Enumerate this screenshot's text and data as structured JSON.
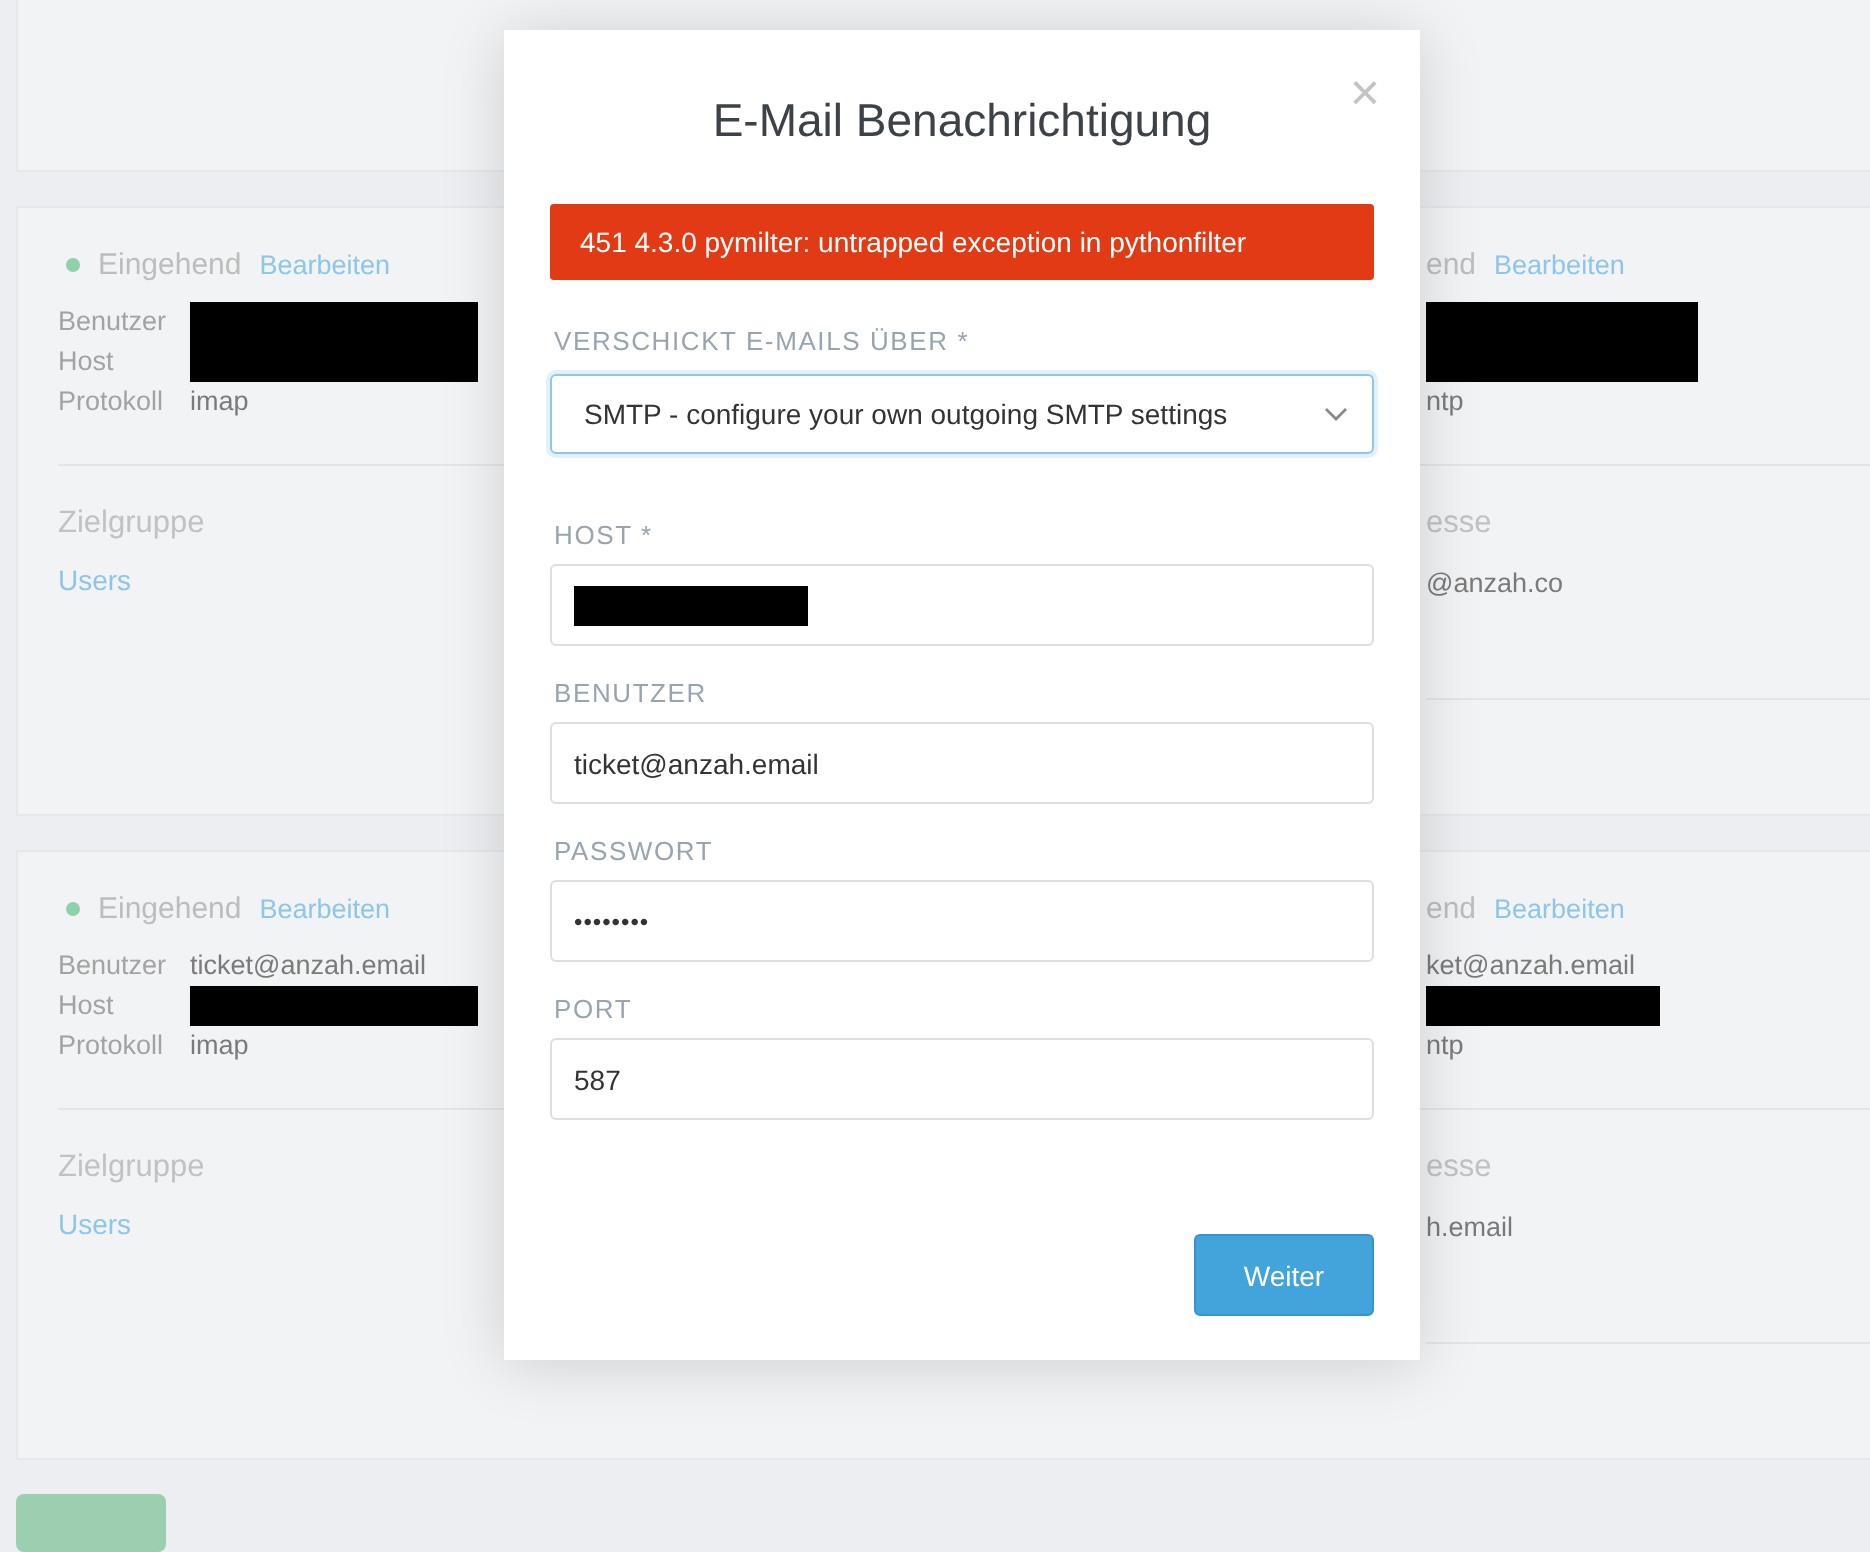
{
  "cards": [
    {
      "left": {
        "status": {
          "label": "Eingehend",
          "color": "#8fd1a8"
        },
        "edit_link": "Bearbeiten",
        "fields": [
          {
            "label": "Benutzer",
            "kind": "redacted"
          },
          {
            "label": "Host",
            "kind": "redacted"
          },
          {
            "label": "Protokoll",
            "kind": "text",
            "value": "imap"
          }
        ],
        "section": {
          "title": "Zielgruppe",
          "link": "Users"
        }
      },
      "right": {
        "status_fragment": "end",
        "edit_link": "Bearbeiten",
        "fields": [
          {
            "kind": "redacted"
          },
          {
            "kind": "redacted"
          },
          {
            "kind": "text",
            "value": "ntp"
          }
        ],
        "section": {
          "title_fragment": "esse",
          "value_fragment": "@anzah.co"
        }
      }
    },
    {
      "left": {
        "status": {
          "label": "Eingehend",
          "color": "#8fd1a8"
        },
        "edit_link": "Bearbeiten",
        "fields": [
          {
            "label": "Benutzer",
            "kind": "text",
            "value": "ticket@anzah.email"
          },
          {
            "label": "Host",
            "kind": "redacted"
          },
          {
            "label": "Protokoll",
            "kind": "text",
            "value": "imap"
          }
        ],
        "section": {
          "title": "Zielgruppe",
          "link": "Users"
        }
      },
      "right": {
        "status_fragment": "end",
        "edit_link": "Bearbeiten",
        "fields": [
          {
            "kind": "text",
            "value": "ket@anzah.email"
          },
          {
            "kind": "redacted"
          },
          {
            "kind": "text",
            "value": "ntp"
          }
        ],
        "section": {
          "title_fragment": "esse",
          "value_fragment": "h.email"
        }
      }
    }
  ],
  "modal": {
    "title": "E-Mail Benachrichtigung",
    "close": "×",
    "error": "451 4.3.0 pymilter: untrapped exception in pythonfilter",
    "send_via": {
      "label": "VERSCHICKT E-MAILS ÜBER *",
      "value": "SMTP - configure your own outgoing SMTP settings"
    },
    "fields": [
      {
        "label": "HOST *",
        "kind": "redacted"
      },
      {
        "label": "BENUTZER",
        "kind": "text",
        "value": "ticket@anzah.email"
      },
      {
        "label": "PASSWORT",
        "kind": "password",
        "value": "••••••••"
      },
      {
        "label": "PORT",
        "kind": "text",
        "value": "587"
      }
    ],
    "button": "Weiter"
  }
}
